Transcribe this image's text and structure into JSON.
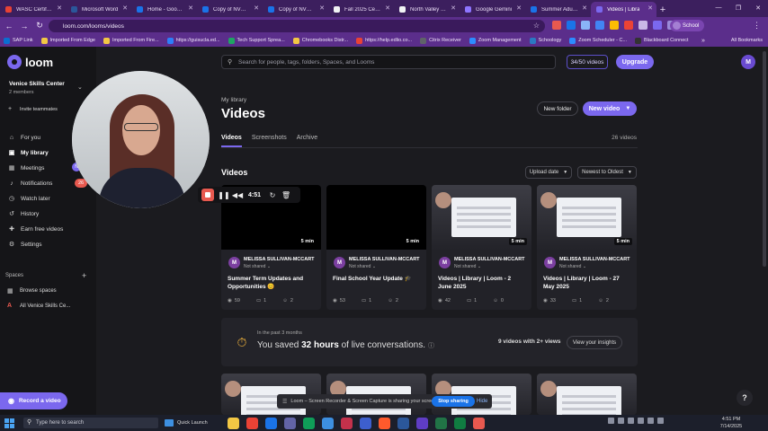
{
  "browser": {
    "tabs": [
      {
        "label": "WASC Certificate",
        "active": false,
        "color": "#e94235"
      },
      {
        "label": "Microsoft Word",
        "active": false,
        "color": "#2b579a"
      },
      {
        "label": "Home - Google D",
        "active": false,
        "color": "#1a73e8"
      },
      {
        "label": "Copy of NVOC W",
        "active": false,
        "color": "#1a73e8"
      },
      {
        "label": "Copy of NVOC W",
        "active": false,
        "color": "#1a73e8"
      },
      {
        "label": "Fall 2025 Certific",
        "active": false,
        "color": "#f1f3f4"
      },
      {
        "label": "North Valley Occ",
        "active": false,
        "color": "#f1f3f4"
      },
      {
        "label": "Google Gemini",
        "active": false,
        "color": "#8e75ff"
      },
      {
        "label": "Summer Adult S",
        "active": false,
        "color": "#1a73e8"
      },
      {
        "label": "Videos | Libra",
        "active": true,
        "color": "#7b68ee"
      }
    ],
    "new_tab": "+",
    "url": "loom.com/looms/videos",
    "profile_label": "School",
    "bookmarks": [
      {
        "label": "SAP Link",
        "color": "#0a6ed1"
      },
      {
        "label": "Imported From Edge",
        "color": "#f2c744"
      },
      {
        "label": "Imported From Fire...",
        "color": "#f2c744"
      },
      {
        "label": "https://guisucla.ed...",
        "color": "#2d7ff9"
      },
      {
        "label": "Tech Support Sprea...",
        "color": "#1fa463"
      },
      {
        "label": "Chromebooks Distr...",
        "color": "#f2c744"
      },
      {
        "label": "https://help.edlio.co...",
        "color": "#e94235"
      },
      {
        "label": "Citrix Receiver",
        "color": "#5f6368"
      },
      {
        "label": "Zoom Management",
        "color": "#2d8cff"
      },
      {
        "label": "Schoology",
        "color": "#2b79c2"
      },
      {
        "label": "Zoom Scheduler - C...",
        "color": "#2d8cff"
      },
      {
        "label": "Blackboard Connect",
        "color": "#333"
      }
    ],
    "bookmarks_more": "»",
    "all_bookmarks": "All Bookmarks"
  },
  "sidebar": {
    "logo": "loom",
    "workspace_name": "Venice Skills Center",
    "workspace_members": "2 members",
    "invite": "Invite teammates",
    "items": [
      {
        "label": "For you",
        "icon": "home-icon"
      },
      {
        "label": "My library",
        "icon": "library-icon",
        "active": true
      },
      {
        "label": "Meetings",
        "icon": "calendar-icon",
        "badge": "N"
      },
      {
        "label": "Notifications",
        "icon": "bell-icon",
        "badge": "26"
      },
      {
        "label": "Watch later",
        "icon": "clock-icon"
      },
      {
        "label": "History",
        "icon": "history-icon"
      },
      {
        "label": "Earn free videos",
        "icon": "gift-icon"
      },
      {
        "label": "Settings",
        "icon": "gear-icon"
      }
    ],
    "spaces_label": "Spaces",
    "spaces": [
      {
        "label": "Browse spaces",
        "icon": "grid-icon"
      },
      {
        "label": "All Venice Skills Ce...",
        "icon": "letter-a-icon",
        "letter": "A"
      }
    ],
    "record_button": "Record a video"
  },
  "main": {
    "search_placeholder": "Search for people, tags, folders, Spaces, and Looms",
    "quota": "34/50 videos",
    "upgrade": "Upgrade",
    "user_initial": "M",
    "breadcrumb": "My library",
    "title": "Videos",
    "new_folder": "New folder",
    "new_video": "New video",
    "tabs": [
      {
        "label": "Videos",
        "active": true
      },
      {
        "label": "Screenshots",
        "active": false
      },
      {
        "label": "Archive",
        "active": false
      }
    ],
    "video_count": "26 videos",
    "section_title": "Videos",
    "sort_upload": "Upload date",
    "sort_order": "Newest to Oldest",
    "cards": [
      {
        "owner": "MELISSA SULLIVAN-MCCART",
        "shared": "Not shared",
        "title": "Summer Term Updates and Opportunities 😊",
        "duration": "5 min",
        "views": "59",
        "comments": "1",
        "reactions": "2",
        "thumb": "black"
      },
      {
        "owner": "MELISSA SULLIVAN-MCCART",
        "shared": "Not shared",
        "title": "Final School Year Update 🎓",
        "duration": "5 min",
        "views": "53",
        "comments": "1",
        "reactions": "2",
        "thumb": "black"
      },
      {
        "owner": "MELISSA SULLIVAN-MCCART",
        "shared": "Not shared",
        "title": "Videos | Library | Loom - 2 June 2025",
        "duration": "5 min",
        "views": "42",
        "comments": "1",
        "reactions": "0",
        "thumb": "screen"
      },
      {
        "owner": "MELISSA SULLIVAN-MCCART",
        "shared": "Not shared",
        "title": "Videos | Library | Loom - 27 May 2025",
        "duration": "5 min",
        "views": "33",
        "comments": "1",
        "reactions": "2",
        "thumb": "screen"
      }
    ],
    "banner": {
      "small": "In the past 3 months",
      "prefix": "You saved ",
      "hours": "32 hours",
      "suffix": " of live conversations.",
      "right": "9 videos with 2+ views",
      "insights": "View your insights"
    }
  },
  "recorder": {
    "timer": "4:51"
  },
  "share_notice": {
    "text": "Loom – Screen Recorder & Screen Capture is sharing your screen.",
    "stop": "Stop sharing",
    "hide": "Hide"
  },
  "taskbar": {
    "search": "Type here to search",
    "quick_launch": "Quick Launch",
    "tray_temp": "",
    "time": "4:51 PM",
    "date": "7/14/2025",
    "apps": [
      "#f2c744",
      "#e94235",
      "#1a73e8",
      "#6264a7",
      "#0f9d58",
      "#3d8fe0",
      "#c4314b",
      "#3d5fce",
      "#ff5a2c",
      "#2b579a",
      "#5f3dc4",
      "#217346",
      "#107c41",
      "#e8594f"
    ]
  }
}
